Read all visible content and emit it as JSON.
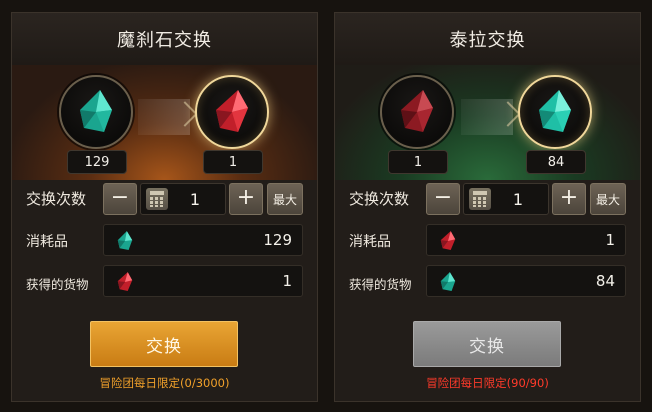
{
  "colors": {
    "teal_gem": "#2fc9b0",
    "red_gem": "#e0303a",
    "button_active": "#e09a2a",
    "button_disabled": "#8a8a8a",
    "limit_orange": "#f0a02a",
    "limit_red": "#ff3a2a"
  },
  "panels": [
    {
      "title": "魔刹石交换",
      "from_icon": "teal-gem-icon",
      "from_count": "129",
      "to_icon": "red-gem-icon",
      "to_count": "1",
      "quantity_label": "交换次数",
      "minus_label": "−",
      "quantity_value": "1",
      "plus_label": "+",
      "max_label": "最大",
      "consume_label": "消耗品",
      "consume_value": "129",
      "gain_label": "获得的货物",
      "gain_value": "1",
      "button_label": "交换",
      "button_state": "active",
      "limit_text": "冒险团每日限定(0/3000)"
    },
    {
      "title": "泰拉交换",
      "from_icon": "red-gem-icon",
      "from_count": "1",
      "to_icon": "teal-gem-icon",
      "to_count": "84",
      "quantity_label": "交换次数",
      "minus_label": "−",
      "quantity_value": "1",
      "plus_label": "+",
      "max_label": "最大",
      "consume_label": "消耗品",
      "consume_value": "1",
      "gain_label": "获得的货物",
      "gain_value": "84",
      "button_label": "交换",
      "button_state": "disabled",
      "limit_text": "冒险团每日限定(90/90)"
    }
  ]
}
